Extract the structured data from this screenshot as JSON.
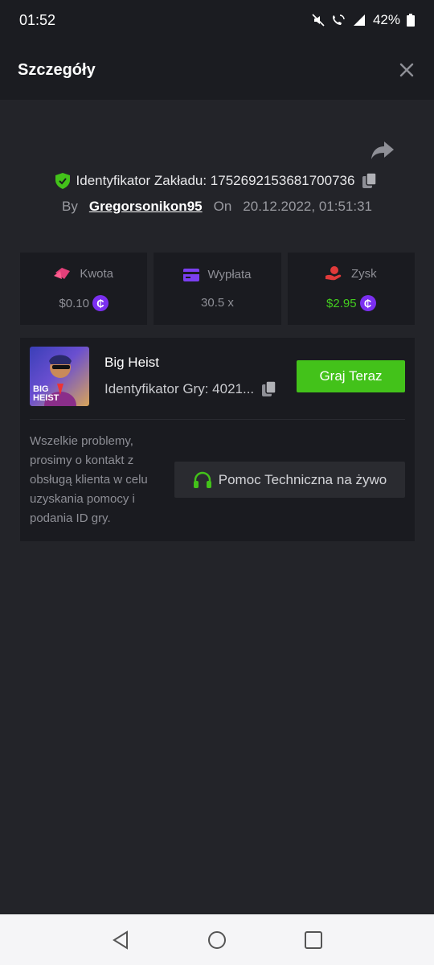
{
  "status": {
    "time": "01:52",
    "battery": "42%"
  },
  "header": {
    "title": "Szczegóły"
  },
  "bet": {
    "id_label": "Identyfikator Zakładu: 1752692153681700736",
    "by_label": "By",
    "username": "Gregorsonikon95",
    "on_label": "On",
    "datetime": "20.12.2022, 01:51:31"
  },
  "stats": {
    "amount": {
      "label": "Kwota",
      "value": "$0.10"
    },
    "payout": {
      "label": "Wypłata",
      "value": "30.5 x"
    },
    "profit": {
      "label": "Zysk",
      "value": "$2.95"
    }
  },
  "game": {
    "name": "Big Heist",
    "thumb_text": "BIG HEIST",
    "id_label": "Identyfikator Gry: 4021...",
    "play_label": "Graj Teraz"
  },
  "support": {
    "text": "Wszelkie problemy, prosimy o kontakt z obsługą klienta w celu uzyskania pomocy i podania ID gry.",
    "button_label": "Pomoc Techniczna na żywo"
  },
  "coin_symbol": "₵",
  "colors": {
    "accent_green": "#43c21a",
    "profit_green": "#43cc1f",
    "coin_purple": "#7b2ff0"
  },
  "icons": [
    "shield-check-icon",
    "copy-icon",
    "share-icon",
    "close-icon",
    "coin-icon",
    "headset-icon"
  ]
}
